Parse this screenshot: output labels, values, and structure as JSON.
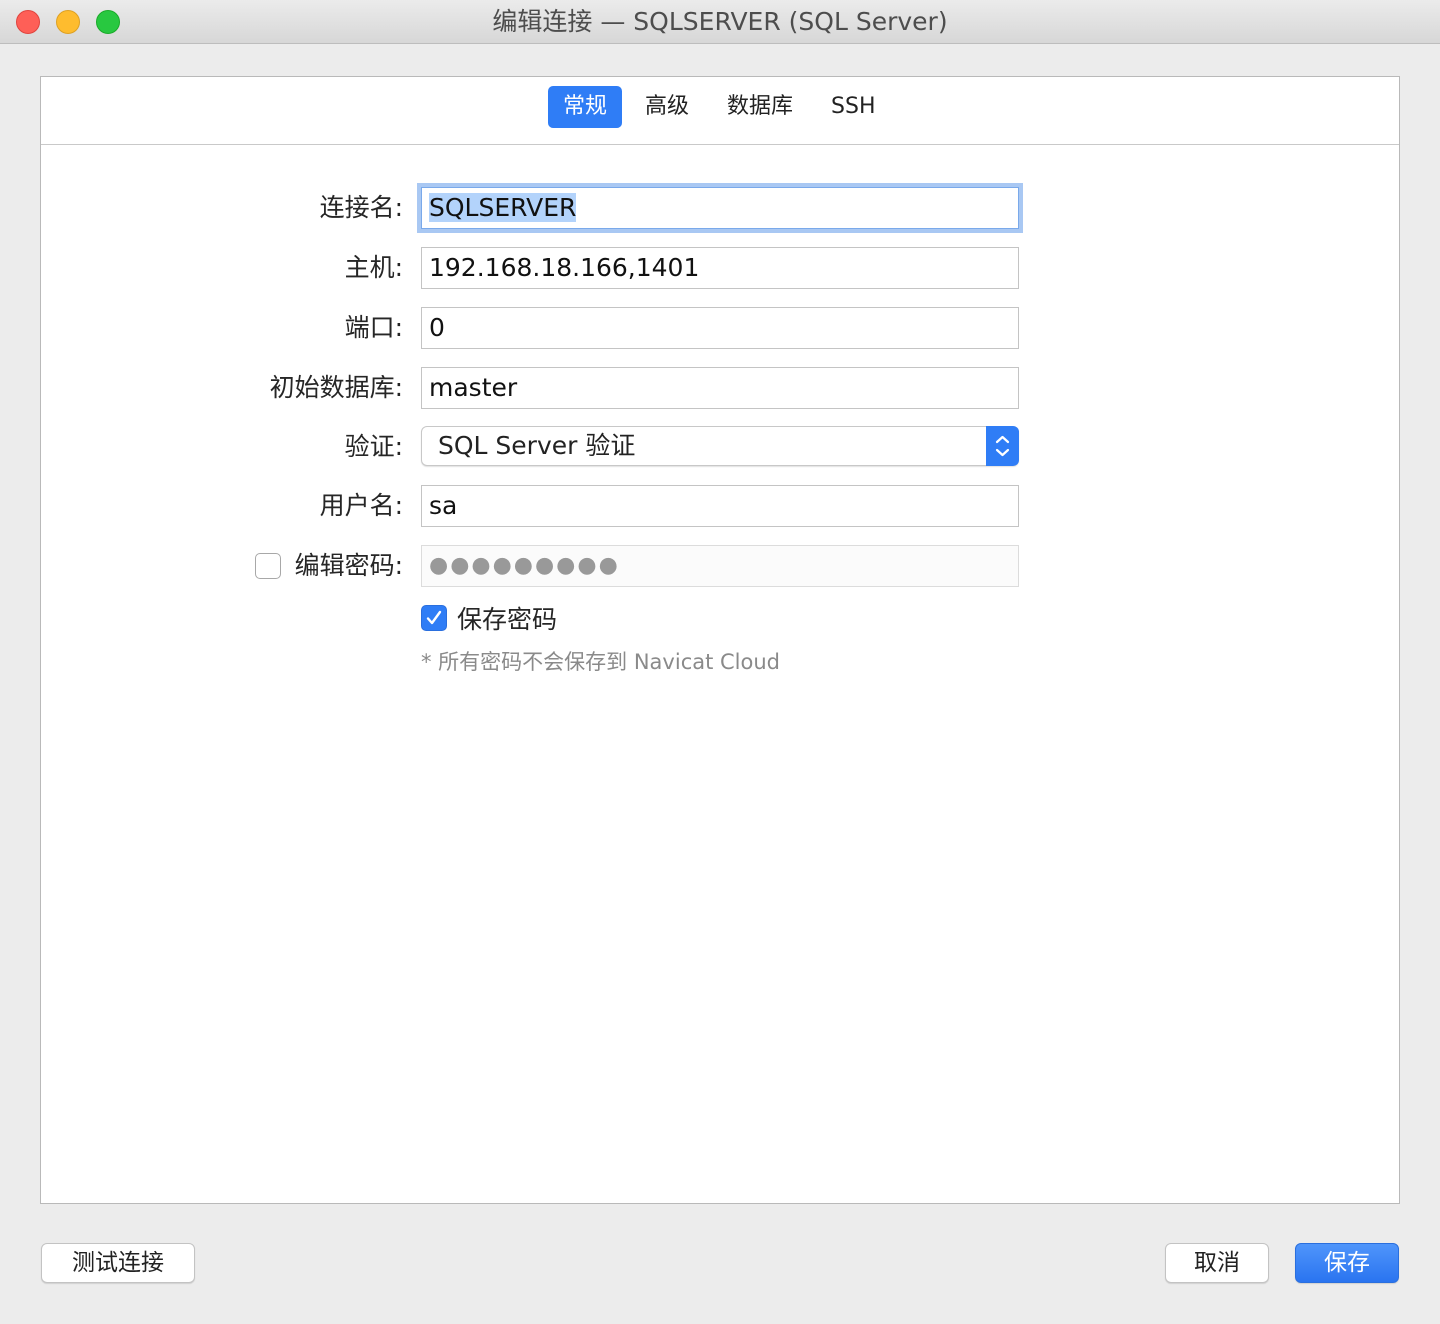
{
  "window": {
    "title": "编辑连接 — SQLSERVER (SQL Server)"
  },
  "tabs": [
    {
      "label": "常规",
      "active": true
    },
    {
      "label": "高级",
      "active": false
    },
    {
      "label": "数据库",
      "active": false
    },
    {
      "label": "SSH",
      "active": false
    }
  ],
  "form": {
    "connection_name": {
      "label": "连接名:",
      "value": "SQLSERVER"
    },
    "host": {
      "label": "主机:",
      "value": "192.168.18.166,1401"
    },
    "port": {
      "label": "端口:",
      "value": "0"
    },
    "initial_db": {
      "label": "初始数据库:",
      "value": "master"
    },
    "auth": {
      "label": "验证:",
      "value": "SQL Server 验证"
    },
    "username": {
      "label": "用户名:",
      "value": "sa"
    },
    "edit_password": {
      "label": "编辑密码:",
      "checked": false,
      "value": "●●●●●●●●●"
    },
    "save_password": {
      "label": "保存密码",
      "checked": true
    },
    "note": "* 所有密码不会保存到 Navicat Cloud"
  },
  "buttons": {
    "test": "测试连接",
    "cancel": "取消",
    "save": "保存"
  },
  "colors": {
    "accent": "#2f7df6",
    "close": "#fe5f57",
    "minimize": "#febc2e",
    "maximize": "#28c840"
  }
}
